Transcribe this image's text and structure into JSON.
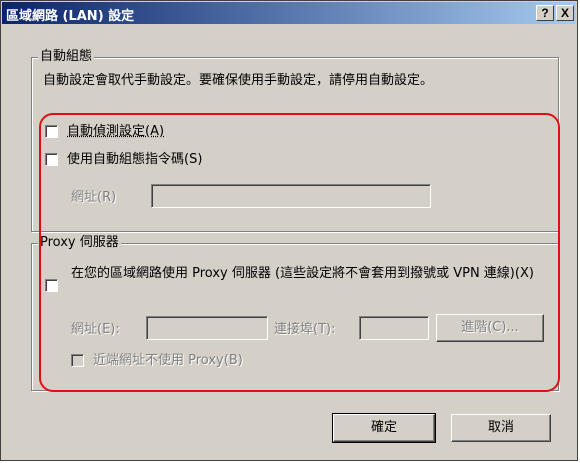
{
  "window": {
    "title": "區域網路 (LAN) 設定",
    "help_label": "?",
    "close_label": "X"
  },
  "auto_config": {
    "group_label": "自動組態",
    "description": "自動設定會取代手動設定。要確保使用手動設定，請停用自動設定。",
    "detect_label": "自動偵測設定(A)",
    "script_label": "使用自動組態指令碼(S)",
    "address_label": "網址(R)",
    "address_value": ""
  },
  "proxy": {
    "group_label": "Proxy 伺服器",
    "use_proxy_label": "在您的區域網路使用 Proxy 伺服器 (這些設定將不會套用到撥號或 VPN 連線)(X)",
    "address_label": "網址(E):",
    "address_value": "",
    "port_label": "連接埠(T):",
    "port_value": "",
    "advanced_label": "進階(C)...",
    "bypass_label": "近端網址不使用 Proxy(B)"
  },
  "buttons": {
    "ok_label": "確定",
    "cancel_label": "取消"
  },
  "highlight_color": "#e01010"
}
